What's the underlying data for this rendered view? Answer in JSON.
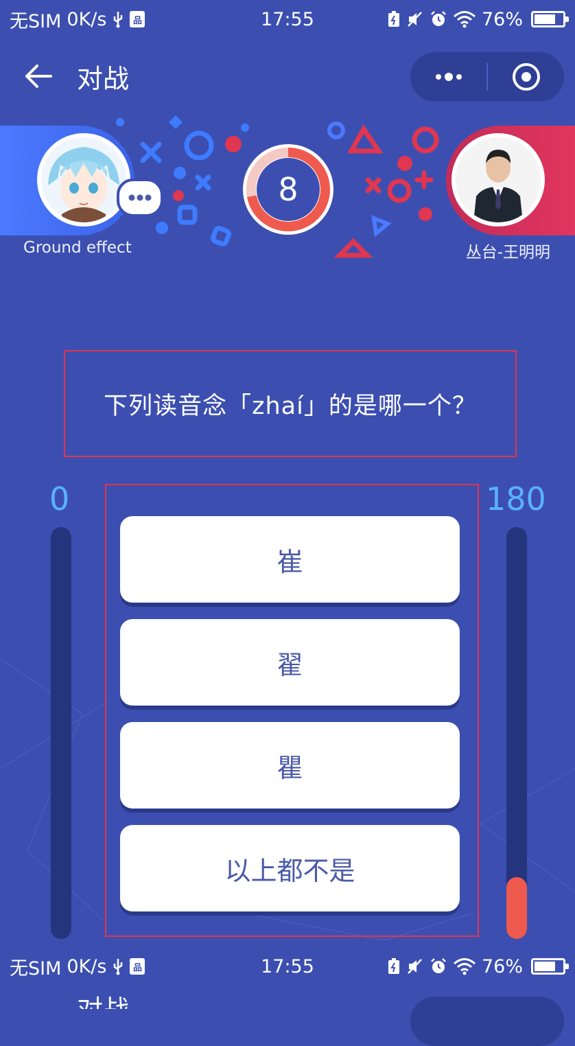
{
  "status_bar": {
    "carrier": "无SIM",
    "speed": "0K/s",
    "time": "17:55",
    "battery_pct": "76%",
    "battery_level": 0.76
  },
  "nav": {
    "title": "对战"
  },
  "battle": {
    "left_player": {
      "name": "Ground effect"
    },
    "right_player": {
      "name": "丛台-王明明"
    },
    "timer": {
      "value": "8",
      "progress": 0.72
    }
  },
  "question": {
    "text": "下列读音念「zhaí」的是哪一个？"
  },
  "scores": {
    "left": "0",
    "right": "180",
    "left_fill": 0.0,
    "right_fill": 0.15
  },
  "answers": [
    {
      "label": "崔"
    },
    {
      "label": "翟"
    },
    {
      "label": "瞿"
    },
    {
      "label": "以上都不是"
    }
  ],
  "colors": {
    "background": "#3c4fb0",
    "left_accent": "#4b79ff",
    "right_accent": "#e1355e",
    "score_text": "#5ab2ff",
    "timer_ring": "#ef5a4f"
  }
}
